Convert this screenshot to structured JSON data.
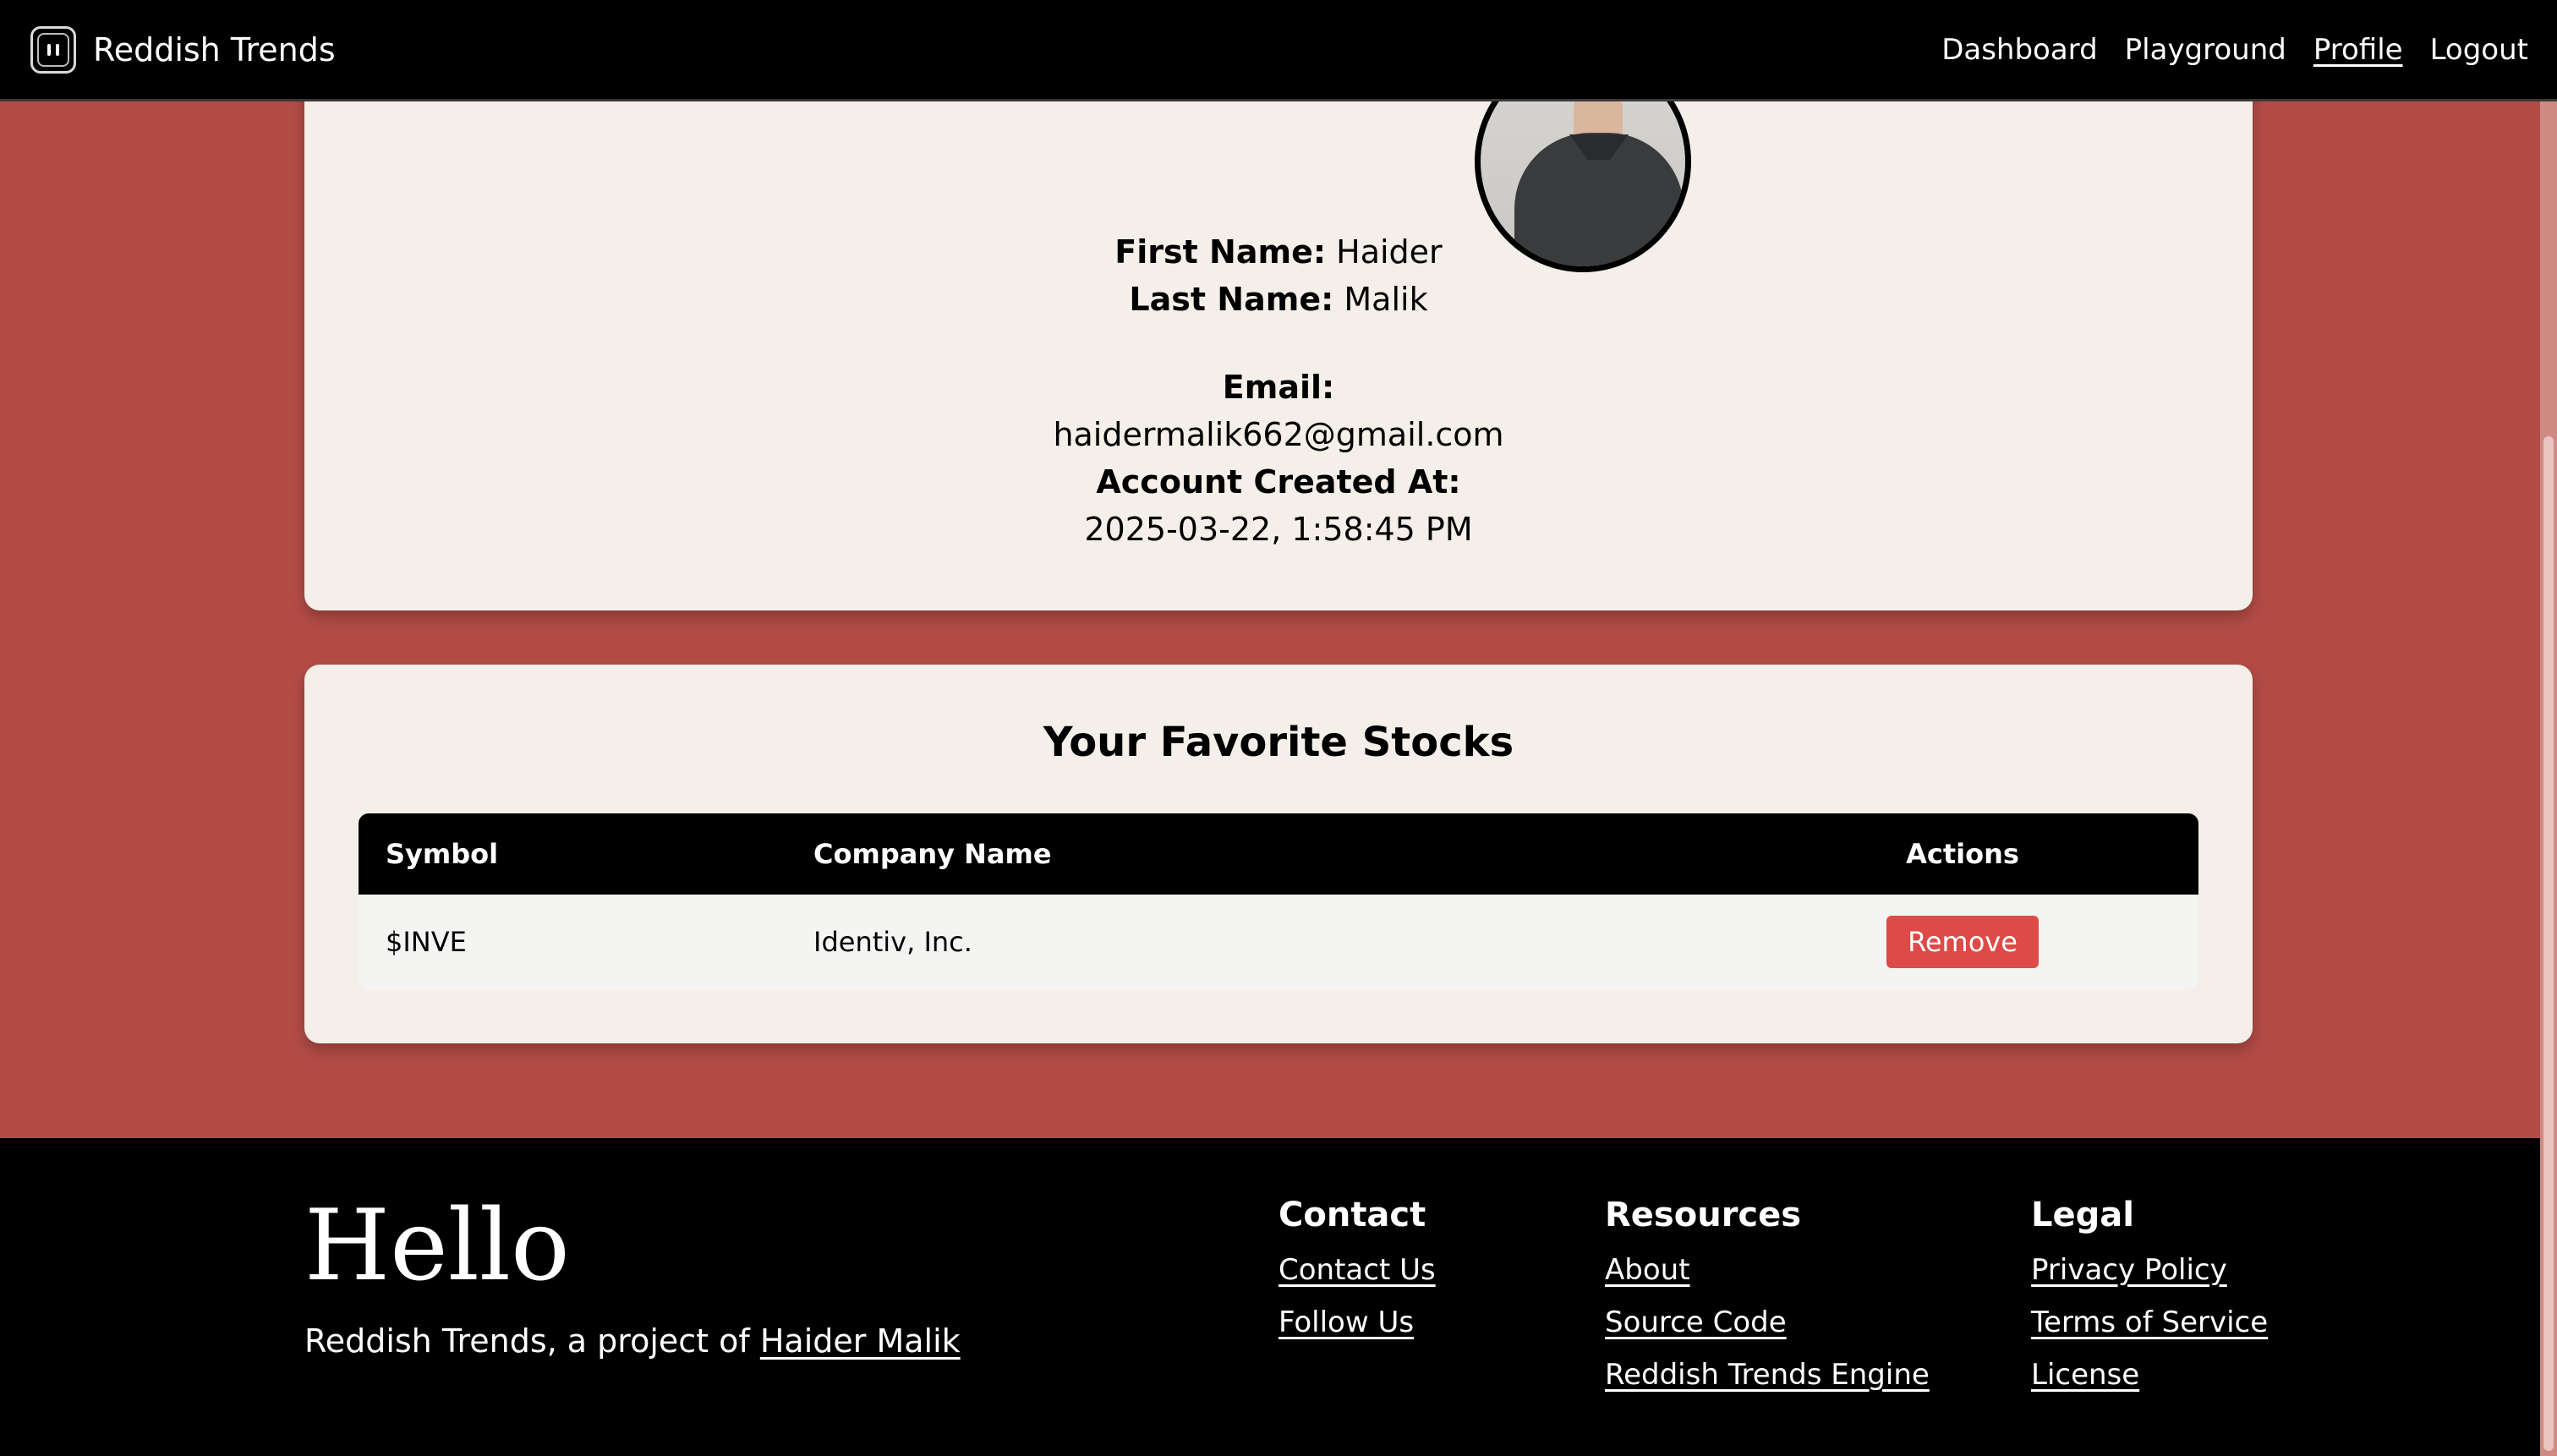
{
  "navbar": {
    "brand": "Reddish Trends",
    "links": [
      "Dashboard",
      "Playground",
      "Profile",
      "Logout"
    ],
    "active": "Profile"
  },
  "profile": {
    "first_name_label": "First Name:",
    "first_name": "Haider",
    "last_name_label": "Last Name:",
    "last_name": "Malik",
    "email_label": "Email:",
    "email": "haidermalik662@gmail.com",
    "created_label": "Account Created At:",
    "created": "2025-03-22, 1:58:45 PM"
  },
  "favorites": {
    "title": "Your Favorite Stocks",
    "headers": [
      "Symbol",
      "Company Name",
      "Actions"
    ],
    "rows": [
      {
        "symbol": "$INVE",
        "company": "Identiv, Inc.",
        "action": "Remove"
      }
    ]
  },
  "footer": {
    "hello": "Hello",
    "tagline_prefix": "Reddish Trends, a project of ",
    "tagline_link": "Haider Malik",
    "contact": {
      "title": "Contact",
      "links": [
        "Contact Us",
        "Follow Us"
      ]
    },
    "resources": {
      "title": "Resources",
      "links": [
        "About",
        "Source Code",
        "Reddish Trends Engine"
      ]
    },
    "legal": {
      "title": "Legal",
      "links": [
        "Privacy Policy",
        "Terms of Service",
        "License"
      ]
    }
  },
  "colors": {
    "page_bg": "#b44c46",
    "card_bg": "#f4efe8",
    "remove_button": "#dc4b47",
    "nav_bg": "#000000"
  }
}
